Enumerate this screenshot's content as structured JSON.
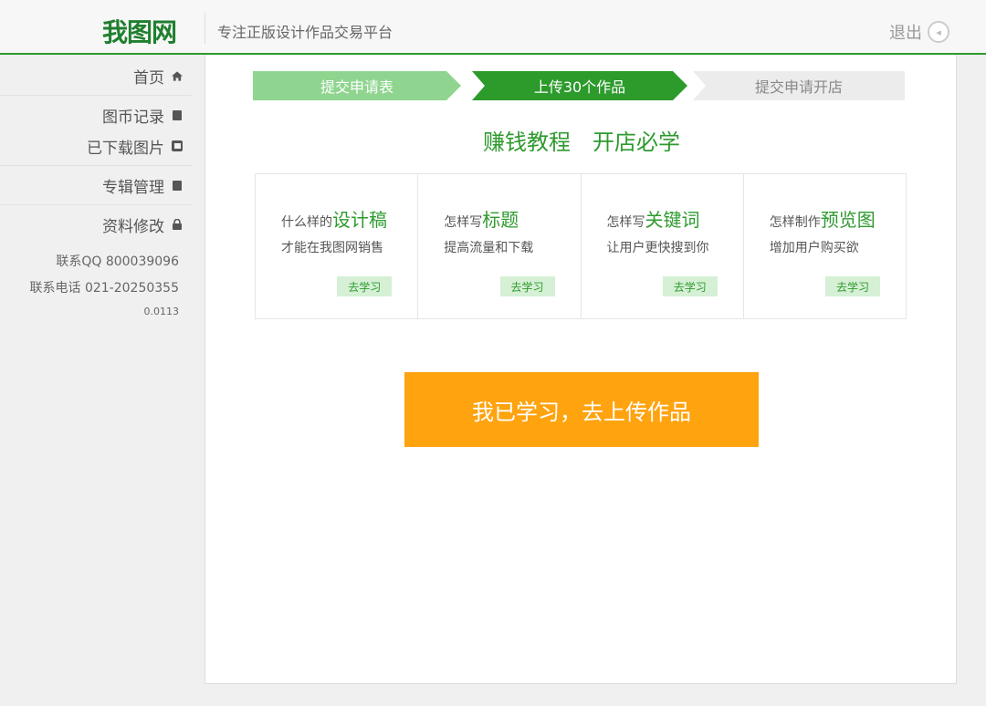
{
  "header": {
    "logo": "我图网",
    "slogan": "专注正版设计作品交易平台",
    "logout_label": "退出",
    "logout_icon": "logout-arrow-icon"
  },
  "sidebar": {
    "groups": [
      {
        "items": [
          {
            "label": "首页",
            "icon": "home-icon"
          }
        ]
      },
      {
        "items": [
          {
            "label": "图币记录",
            "icon": "coin-record-icon"
          },
          {
            "label": "已下载图片",
            "icon": "download-image-icon"
          }
        ]
      },
      {
        "items": [
          {
            "label": "专辑管理",
            "icon": "album-icon"
          }
        ]
      },
      {
        "items": [
          {
            "label": "资料修改",
            "icon": "lock-icon"
          }
        ]
      }
    ],
    "contact_qq": "联系QQ 800039096",
    "contact_phone": "联系电话 021-20250355",
    "version": "0.0113"
  },
  "steps": [
    {
      "label": "提交申请表",
      "state": "done"
    },
    {
      "label": "上传30个作品",
      "state": "active"
    },
    {
      "label": "提交申请开店",
      "state": "pending"
    }
  ],
  "headline": {
    "part1": "赚钱教程",
    "part2": "开店必学"
  },
  "cards": [
    {
      "prefix": "什么样的",
      "keyword": "设计稿",
      "subtitle": "才能在我图网销售",
      "button": "去学习"
    },
    {
      "prefix": "怎样写",
      "keyword": "标题",
      "subtitle": "提高流量和下载",
      "button": "去学习"
    },
    {
      "prefix": "怎样写",
      "keyword": "关键词",
      "subtitle": "让用户更快搜到你",
      "button": "去学习"
    },
    {
      "prefix": "怎样制作",
      "keyword": "预览图",
      "subtitle": "增加用户购买欲",
      "button": "去学习"
    }
  ],
  "cta": {
    "label": "我已学习，去上传作品"
  },
  "colors": {
    "brand_green": "#2e9a2e",
    "step_done": "#8fd58f",
    "step_active": "#2c9b2c",
    "cta_orange": "#ffa30f"
  }
}
